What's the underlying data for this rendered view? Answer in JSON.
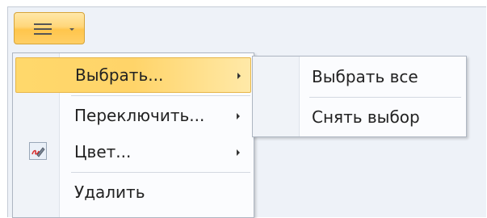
{
  "toolbar": {
    "menu_button_icon": "hamburger-icon",
    "dropdown_icon": "chevron-down-icon",
    "accent": "#ffd06a"
  },
  "context_menu": {
    "items": [
      {
        "label": "Выбрать...",
        "has_submenu": true,
        "selected": true,
        "icon": ""
      },
      {
        "label": "Переключить...",
        "has_submenu": true,
        "selected": false,
        "icon": ""
      },
      {
        "label": "Цвет...",
        "has_submenu": true,
        "selected": false,
        "icon": "color-pen-icon"
      },
      {
        "label": "Удалить",
        "has_submenu": false,
        "selected": false,
        "icon": ""
      }
    ]
  },
  "submenu": {
    "items": [
      {
        "label": "Выбрать все"
      },
      {
        "label": "Снять выбор"
      }
    ]
  }
}
